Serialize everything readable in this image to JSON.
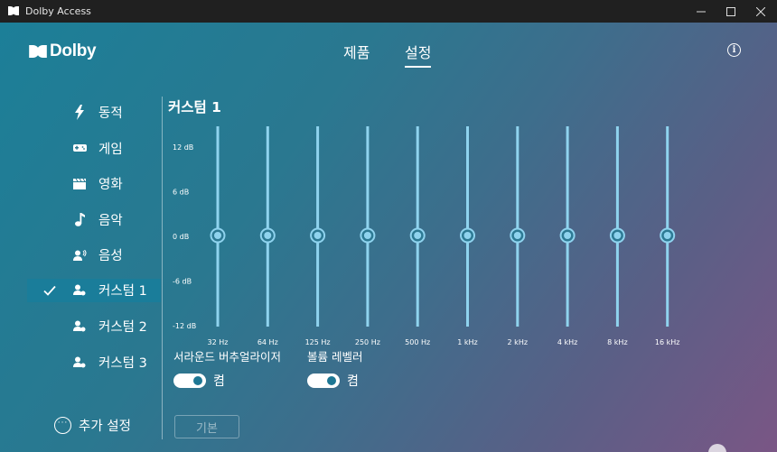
{
  "window": {
    "title": "Dolby Access"
  },
  "brand": {
    "name": "Dolby"
  },
  "top_tabs": [
    {
      "label": "제품",
      "active": false
    },
    {
      "label": "설정",
      "active": true
    }
  ],
  "sidebar": {
    "items": [
      {
        "label": "동적",
        "icon": "lightning-icon",
        "selected": false
      },
      {
        "label": "게임",
        "icon": "gamepad-icon",
        "selected": false
      },
      {
        "label": "영화",
        "icon": "clapperboard-icon",
        "selected": false
      },
      {
        "label": "음악",
        "icon": "music-note-icon",
        "selected": false
      },
      {
        "label": "음성",
        "icon": "voice-icon",
        "selected": false
      },
      {
        "label": "커스텀 1",
        "icon": "custom-profile-icon",
        "selected": true
      },
      {
        "label": "커스텀 2",
        "icon": "custom-profile-icon",
        "selected": false
      },
      {
        "label": "커스텀 3",
        "icon": "custom-profile-icon",
        "selected": false
      }
    ],
    "more_label": "추가 설정"
  },
  "equalizer": {
    "title": "커스텀 1",
    "db_labels": [
      "12 dB",
      "6 dB",
      "0 dB",
      "-6 dB",
      "-12 dB"
    ],
    "db_range": [
      -12,
      12
    ],
    "bands": [
      {
        "freq": "32 Hz",
        "gain_db": 0
      },
      {
        "freq": "64 Hz",
        "gain_db": 0
      },
      {
        "freq": "125 Hz",
        "gain_db": 0
      },
      {
        "freq": "250 Hz",
        "gain_db": 0
      },
      {
        "freq": "500 Hz",
        "gain_db": 0
      },
      {
        "freq": "1 kHz",
        "gain_db": 0
      },
      {
        "freq": "2 kHz",
        "gain_db": 0
      },
      {
        "freq": "4 kHz",
        "gain_db": 0
      },
      {
        "freq": "8 kHz",
        "gain_db": 0
      },
      {
        "freq": "16 kHz",
        "gain_db": 0
      }
    ],
    "slider_color": "#8fd3ee"
  },
  "effects": [
    {
      "label": "서라운드 버추얼라이저",
      "state_label": "켬",
      "on": true
    },
    {
      "label": "볼륨 레벨러",
      "state_label": "켬",
      "on": true
    }
  ],
  "reset_label": "기본"
}
